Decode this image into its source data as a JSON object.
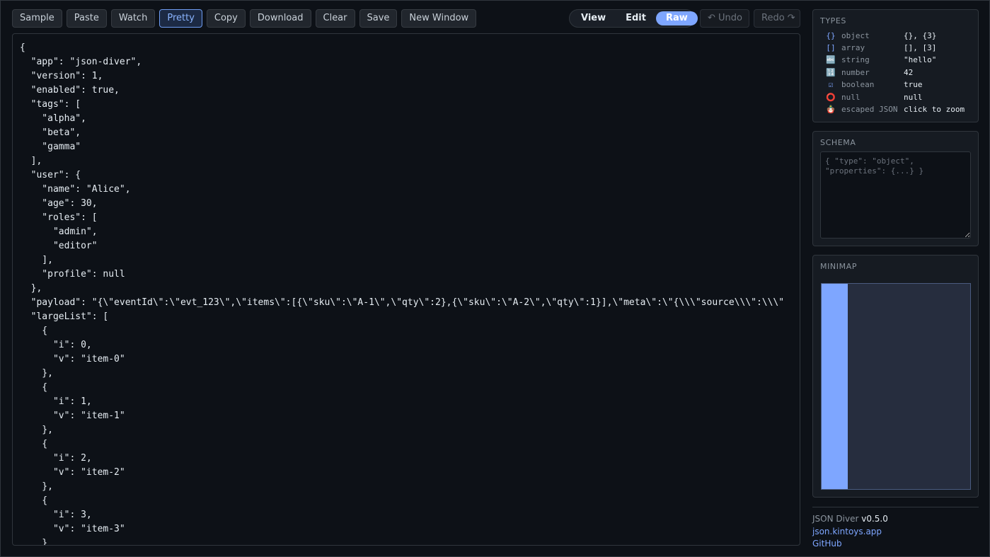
{
  "toolbar": {
    "buttons": [
      "Sample",
      "Paste",
      "Watch",
      "Pretty",
      "Copy",
      "Download",
      "Clear",
      "Save",
      "New Window"
    ]
  },
  "view_modes": [
    "View",
    "Edit",
    "Raw"
  ],
  "history": {
    "undo": "↶ Undo",
    "redo": "Redo ↷"
  },
  "editor": {
    "content": "{\n  \"app\": \"json-diver\",\n  \"version\": 1,\n  \"enabled\": true,\n  \"tags\": [\n    \"alpha\",\n    \"beta\",\n    \"gamma\"\n  ],\n  \"user\": {\n    \"name\": \"Alice\",\n    \"age\": 30,\n    \"roles\": [\n      \"admin\",\n      \"editor\"\n    ],\n    \"profile\": null\n  },\n  \"payload\": \"{\\\"eventId\\\":\\\"evt_123\\\",\\\"items\\\":[{\\\"sku\\\":\\\"A-1\\\",\\\"qty\\\":2},{\\\"sku\\\":\\\"A-2\\\",\\\"qty\\\":1}],\\\"meta\\\":\\\"{\\\\\\\"source\\\\\\\":\\\\\\\"\n  \"largeList\": [\n    {\n      \"i\": 0,\n      \"v\": \"item-0\"\n    },\n    {\n      \"i\": 1,\n      \"v\": \"item-1\"\n    },\n    {\n      \"i\": 2,\n      \"v\": \"item-2\"\n    },\n    {\n      \"i\": 3,\n      \"v\": \"item-3\"\n    }"
  },
  "types": {
    "title": "TYPES",
    "rows": [
      {
        "icon": "{}",
        "name": "object",
        "example": "{}, {3}"
      },
      {
        "icon": "[]",
        "name": "array",
        "example": "[], [3]"
      },
      {
        "icon": "🔤",
        "name": "string",
        "example": "\"hello\""
      },
      {
        "icon": "🔢",
        "name": "number",
        "example": "42"
      },
      {
        "icon": "☑",
        "name": "boolean",
        "example": "true"
      },
      {
        "icon": "⭕",
        "name": "null",
        "example": "null"
      },
      {
        "icon": "🪆",
        "name": "escaped JSON",
        "example": "click to zoom"
      }
    ]
  },
  "schema": {
    "title": "SCHEMA",
    "placeholder": "{ \"type\": \"object\", \"properties\": {...} }"
  },
  "minimap": {
    "title": "MINIMAP"
  },
  "footer": {
    "app_name": "JSON Diver",
    "version": "v0.5.0",
    "site_link": "json.kintoys.app",
    "github_link": "GitHub"
  },
  "colors": {
    "accent": "#7ea6ff",
    "background": "#0d1117",
    "panel": "#161b22"
  }
}
